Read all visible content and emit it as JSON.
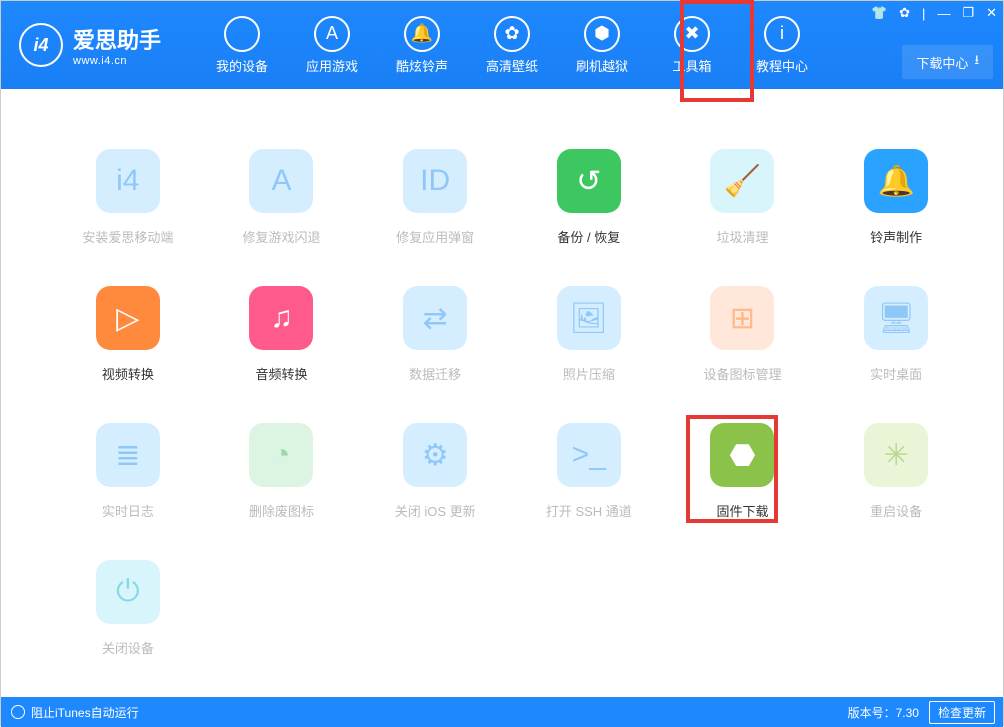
{
  "brand": {
    "name": "爱思助手",
    "url": "www.i4.cn",
    "logo": "i4"
  },
  "nav": [
    {
      "label": "我的设备",
      "glyph": ""
    },
    {
      "label": "应用游戏",
      "glyph": "A"
    },
    {
      "label": "酷炫铃声",
      "glyph": "🔔"
    },
    {
      "label": "高清壁纸",
      "glyph": "✿"
    },
    {
      "label": "刷机越狱",
      "glyph": "⬢"
    },
    {
      "label": "工具箱",
      "glyph": "✖"
    },
    {
      "label": "教程中心",
      "glyph": "i"
    }
  ],
  "download_center": "下载中心",
  "window_controls": {
    "tshirt": "👕",
    "settings": "✿",
    "sep": "|",
    "min": "—",
    "restore": "❐",
    "close": "✕"
  },
  "tools": [
    {
      "label": "安装爱思移动端",
      "glyph": "i4",
      "cls": "bg-lblue",
      "dim": true
    },
    {
      "label": "修复游戏闪退",
      "glyph": "A",
      "cls": "bg-lblue",
      "dim": true
    },
    {
      "label": "修复应用弹窗",
      "glyph": "ID",
      "cls": "bg-lblue",
      "dim": true
    },
    {
      "label": "备份 / 恢复",
      "glyph": "↺",
      "cls": "bg-green",
      "dim": false
    },
    {
      "label": "垃圾清理",
      "glyph": "🧹",
      "cls": "bg-lcyan",
      "dim": true
    },
    {
      "label": "铃声制作",
      "glyph": "🔔",
      "cls": "bg-blue",
      "dim": false
    },
    {
      "label": "视频转换",
      "glyph": "▷",
      "cls": "bg-orange",
      "dim": false
    },
    {
      "label": "音频转换",
      "glyph": "♫",
      "cls": "bg-pink",
      "dim": false
    },
    {
      "label": "数据迁移",
      "glyph": "⇄",
      "cls": "bg-lblue",
      "dim": true
    },
    {
      "label": "照片压缩",
      "glyph": "🖼",
      "cls": "bg-lblue",
      "dim": true
    },
    {
      "label": "设备图标管理",
      "glyph": "⊞",
      "cls": "bg-lorange",
      "dim": true
    },
    {
      "label": "实时桌面",
      "glyph": "🖥",
      "cls": "bg-lblue",
      "dim": true
    },
    {
      "label": "实时日志",
      "glyph": "≣",
      "cls": "bg-lblue",
      "dim": true
    },
    {
      "label": "删除废图标",
      "glyph": "◔",
      "cls": "bg-lgreen",
      "dim": true
    },
    {
      "label": "关闭 iOS 更新",
      "glyph": "⚙",
      "cls": "bg-lblue",
      "dim": true
    },
    {
      "label": "打开 SSH 通道",
      "glyph": ">_",
      "cls": "bg-lblue",
      "dim": true
    },
    {
      "label": "固件下载",
      "glyph": "⬣",
      "cls": "bg-lime",
      "dim": false
    },
    {
      "label": "重启设备",
      "glyph": "✳",
      "cls": "bg-llime",
      "dim": true
    },
    {
      "label": "关闭设备",
      "glyph": "⏻",
      "cls": "bg-lcyan",
      "dim": true
    }
  ],
  "footer": {
    "itunes_block": "阻止iTunes自动运行",
    "version_label": "版本号：",
    "version": "7.30",
    "update_btn": "检查更新"
  }
}
